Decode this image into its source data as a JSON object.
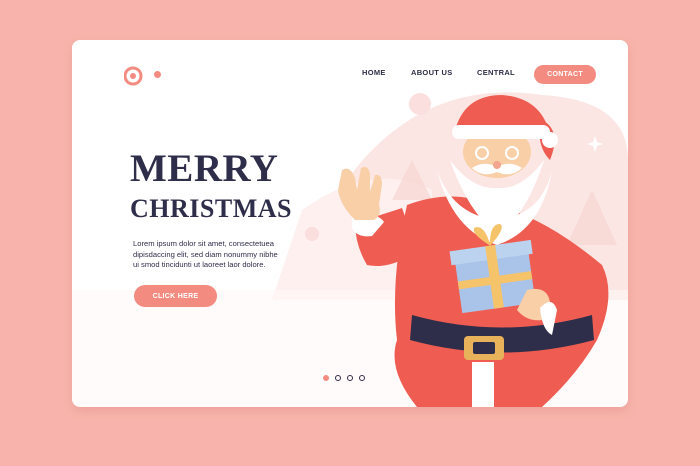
{
  "colors": {
    "background": "#f8b4ac",
    "accent": "#f48b80",
    "text": "#2f2e4a",
    "card": "#ffffff"
  },
  "nav": {
    "home": "HOME",
    "about": "ABOUT US",
    "central": "CENTRAL",
    "contact": "CONTACT"
  },
  "hero": {
    "title_line1": "MERRY",
    "title_line2": "CHRISTMAS",
    "body_lines": [
      "Lorem ipsum dolor sit amet, consectetuea",
      "dipisdaccing elit, sed diam nonummy nibhe",
      "ui smod tincidunti ut laoreet  laor dolore."
    ],
    "cta": "CLICK HERE"
  },
  "pagination": {
    "count": 4,
    "active": 0
  },
  "illustration": {
    "subject": "santa-claus-holding-gift",
    "icons": [
      "logo-icon",
      "sparkle-icon"
    ]
  }
}
